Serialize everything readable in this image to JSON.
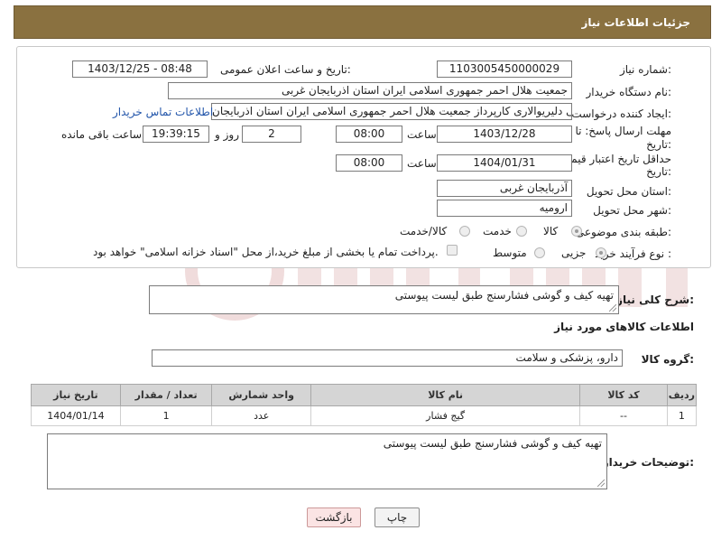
{
  "header": {
    "title": "جزئیات اطلاعات نیاز"
  },
  "form": {
    "need_number_label": "شماره نیاز:",
    "need_number": "1103005450000029",
    "announce_label": "تاریخ و ساعت اعلان عمومی:",
    "announce_value": "1403/12/25 - 08:48",
    "buyer_label": "نام دستگاه خریدار:",
    "buyer_value": "جمعیت هلال احمر جمهوری اسلامی ایران استان اذربایجان غربی",
    "creator_label": "ایجاد کننده درخواست:",
    "creator_value": "علی دلیریوالاری کارپرداز جمعیت هلال احمر جمهوری اسلامی ایران استان اذربایجان",
    "contact_link": "اطلاعات تماس خریدار",
    "deadline_label_1": "مهلت ارسال پاسخ: تا",
    "deadline_label_2": "تاریخ:",
    "deadline_date": "1403/12/28",
    "time_label": "ساعت",
    "deadline_time": "08:00",
    "days_value": "2",
    "days_label": "روز و",
    "remaining_time": "19:39:15",
    "remaining_label": "ساعت باقی مانده",
    "validity_label_1": "حداقل تاریخ اعتبار قیمت: تا",
    "validity_label_2": "تاریخ:",
    "validity_date": "1404/01/31",
    "validity_time": "08:00",
    "province_label": "استان محل تحویل:",
    "province_value": "آذربایجان غربی",
    "city_label": "شهر محل تحویل:",
    "city_value": "ارومیه",
    "category_label": "طبقه بندی موضوعی:",
    "category_options": [
      "کالا",
      "خدمت",
      "کالا/خدمت"
    ],
    "process_label": "نوع فرآیند خرید :",
    "process_options": [
      "جزیی",
      "متوسط"
    ],
    "payment_note": "پرداخت تمام یا بخشی از مبلغ خرید،از محل \"اسناد خزانه اسلامی\" خواهد بود."
  },
  "description": {
    "label": "شرح کلی نیاز:",
    "value": "تهیه کیف و گوشی فشارسنج طبق لیست پیوستی"
  },
  "goods_section": {
    "title": "اطلاعات کالاهای مورد نیاز"
  },
  "goods_group": {
    "label": "گروه کالا:",
    "value": "دارو، پزشکی و سلامت"
  },
  "table": {
    "headers": [
      "ردیف",
      "کد کالا",
      "نام کالا",
      "واحد شمارش",
      "تعداد / مقدار",
      "تاریخ نیاز"
    ],
    "rows": [
      [
        "1",
        "--",
        "گیج فشار",
        "عدد",
        "1",
        "1404/01/14"
      ]
    ]
  },
  "buyer_notes": {
    "label": "توضیحات خریدار:",
    "value": "تهیه کیف و گوشی فشارسنج طبق لیست پیوستی"
  },
  "buttons": {
    "print": "چاپ",
    "back": "بازگشت"
  },
  "colors": {
    "header_bg": "#8a7140",
    "link": "#2255aa",
    "table_header": "#d5d5d5"
  }
}
